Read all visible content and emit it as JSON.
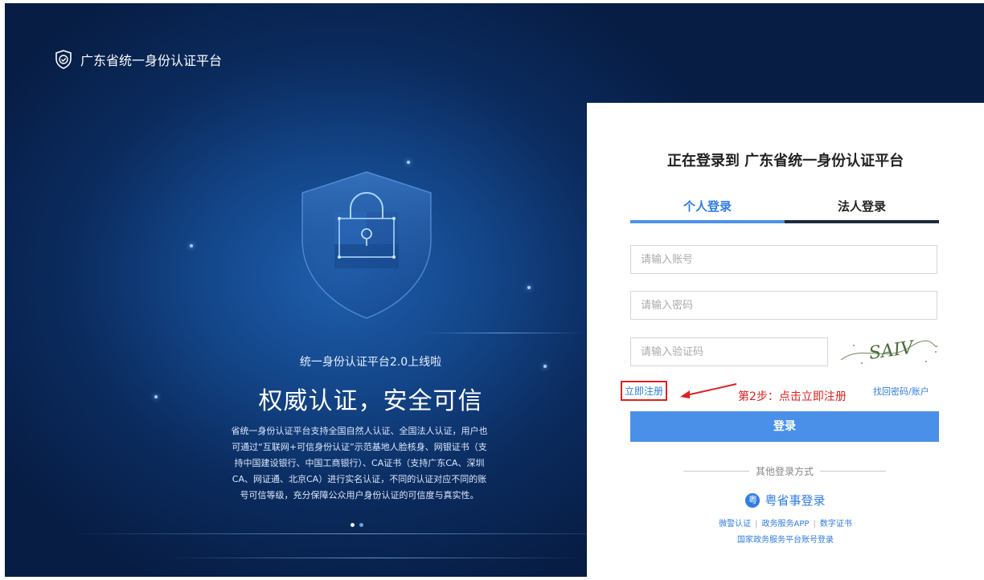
{
  "brand": {
    "title": "广东省统一身份认证平台"
  },
  "hero": {
    "small_slogan": "统一身份认证平台2.0上线啦",
    "big_slogan": "权威认证，安全可信",
    "description": "省统一身份认证平台支持全国自然人认证、全国法人认证，用户也可通过“互联网+可信身份认证”示范基地人脸核身、网银证书（支持中国建设银行、中国工商银行）、CA证书（支持广东CA、深圳CA、网证通、北京CA）进行实名认证，不同的认证对应不同的账号可信等级，充分保障公众用户身份认证的可信度与真实性。"
  },
  "login": {
    "title": "正在登录到 广东省统一身份认证平台",
    "tabs": [
      {
        "label": "个人登录"
      },
      {
        "label": "法人登录"
      }
    ],
    "account_placeholder": "请输入账号",
    "password_placeholder": "请输入密码",
    "captcha_placeholder": "请输入验证码",
    "captcha_text": "SAIV",
    "register_label": "立即注册",
    "annotation": "第2步：点击立即注册",
    "forgot_label": "找回密码/账户",
    "login_button": "登录",
    "other_methods": "其他登录方式",
    "yss_label": "粤省事登录",
    "yss_icon": "粤",
    "links": [
      "微警认证",
      "政务服务APP",
      "数字证书"
    ],
    "gov_link": "国家政务服务平台账号登录"
  },
  "colors": {
    "accent": "#4a90e8",
    "annotation": "#e02020",
    "hero_dark": "#071d44"
  }
}
